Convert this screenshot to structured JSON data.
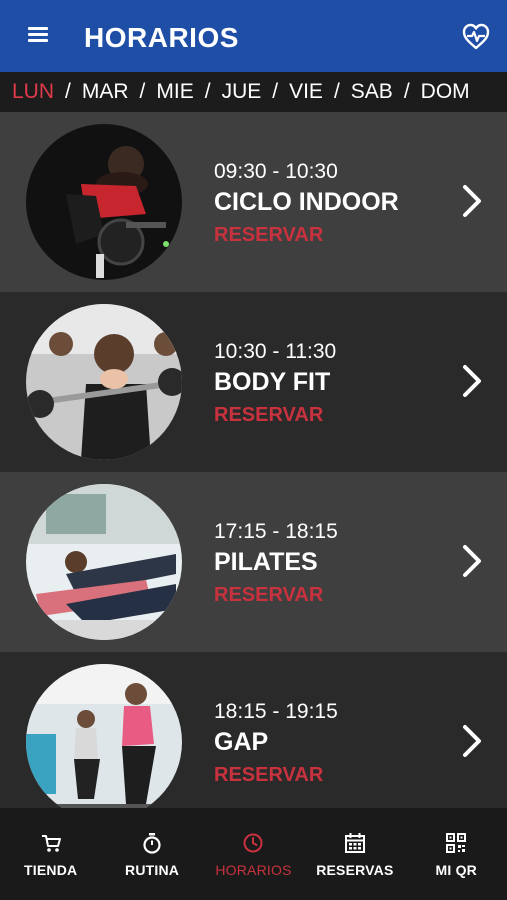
{
  "appbar": {
    "title": "HORARIOS",
    "menu_icon": "hamburger-menu-icon",
    "action_icon": "heart-pulse-icon"
  },
  "days": [
    {
      "label": "LUN",
      "active": true
    },
    {
      "label": "MAR",
      "active": false
    },
    {
      "label": "MIE",
      "active": false
    },
    {
      "label": "JUE",
      "active": false
    },
    {
      "label": "VIE",
      "active": false
    },
    {
      "label": "SAB",
      "active": false
    },
    {
      "label": "DOM",
      "active": false
    }
  ],
  "day_separator": "/",
  "classes": [
    {
      "time": "09:30 - 10:30",
      "name": "CICLO INDOOR",
      "action": "RESERVAR",
      "image": "indoor-cycling-photo"
    },
    {
      "time": "10:30 - 11:30",
      "name": "BODY FIT",
      "action": "RESERVAR",
      "image": "barbell-class-photo"
    },
    {
      "time": "17:15 - 18:15",
      "name": "PILATES",
      "action": "RESERVAR",
      "image": "pilates-class-photo"
    },
    {
      "time": "18:15 - 19:15",
      "name": "GAP",
      "action": "RESERVAR",
      "image": "step-aerobics-photo"
    }
  ],
  "bottom_nav": [
    {
      "label": "TIENDA",
      "icon": "cart-icon",
      "active": false
    },
    {
      "label": "RUTINA",
      "icon": "stopwatch-icon",
      "active": false
    },
    {
      "label": "HORARIOS",
      "icon": "clock-icon",
      "active": true
    },
    {
      "label": "RESERVAS",
      "icon": "calendar-icon",
      "active": false
    },
    {
      "label": "MI QR",
      "icon": "qr-code-icon",
      "active": false
    }
  ],
  "colors": {
    "appbar": "#1f4ea6",
    "accent": "#c8323f",
    "active_day": "#e0394a",
    "row_light": "#3f3f3f",
    "row_dark": "#2a2a2a",
    "nav_bg": "#1a1a1a"
  }
}
